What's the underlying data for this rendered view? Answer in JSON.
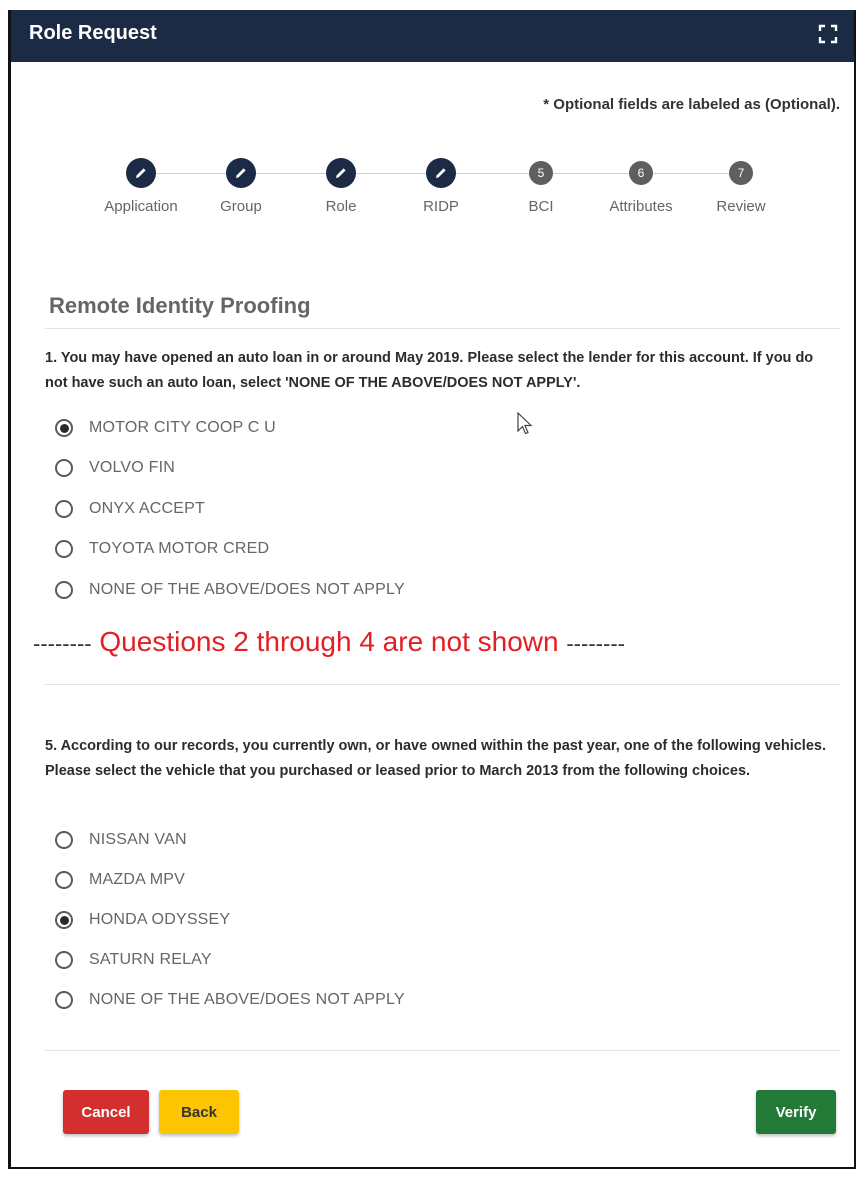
{
  "window": {
    "title": "Role Request",
    "expand_icon": "fullscreen-icon"
  },
  "optional_note": "* Optional fields are labeled as (Optional).",
  "stepper": {
    "steps": [
      {
        "label": "Application",
        "state": "done",
        "icon": "pencil-icon"
      },
      {
        "label": "Group",
        "state": "done",
        "icon": "pencil-icon"
      },
      {
        "label": "Role",
        "state": "done",
        "icon": "pencil-icon"
      },
      {
        "label": "RIDP",
        "state": "done",
        "icon": "pencil-icon"
      },
      {
        "label": "BCI",
        "state": "pending",
        "number": "5"
      },
      {
        "label": "Attributes",
        "state": "pending",
        "number": "6"
      },
      {
        "label": "Review",
        "state": "pending",
        "number": "7"
      }
    ]
  },
  "section_title": "Remote Identity Proofing",
  "question1": {
    "text": "1. You may have opened an auto loan in or around May 2019. Please select the lender for this account. If you do not have such an auto loan, select 'NONE OF THE ABOVE/DOES NOT APPLY'.",
    "options": [
      "MOTOR CITY COOP C U",
      "VOLVO FIN",
      "ONYX ACCEPT",
      "TOYOTA MOTOR CRED",
      "NONE OF THE ABOVE/DOES NOT APPLY"
    ],
    "selected": "MOTOR CITY COOP C U"
  },
  "annotation": {
    "dashes": "--------",
    "text": "Questions 2 through 4 are not shown"
  },
  "question5": {
    "text": "5. According to our records, you currently own, or have owned within the past year, one of the following vehicles. Please select the vehicle that you purchased or leased prior to March 2013 from the following choices.",
    "options": [
      "NISSAN VAN",
      "MAZDA MPV",
      "HONDA ODYSSEY",
      "SATURN RELAY",
      "NONE OF THE ABOVE/DOES NOT APPLY"
    ],
    "selected": "HONDA ODYSSEY"
  },
  "buttons": {
    "cancel": "Cancel",
    "back": "Back",
    "verify": "Verify"
  },
  "colors": {
    "header": "#1c2b45",
    "cancel": "#d32f2f",
    "back": "#fcc500",
    "verify": "#237a37",
    "annotation": "#e31e24"
  }
}
